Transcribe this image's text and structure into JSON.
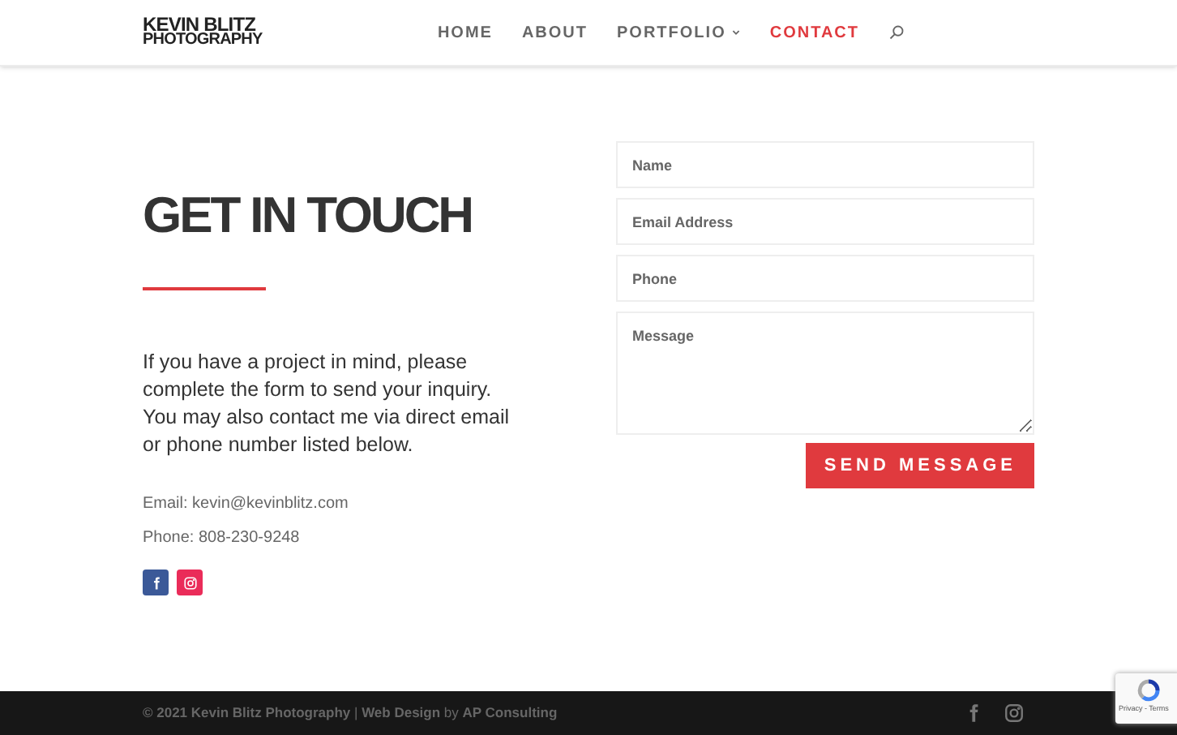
{
  "header": {
    "logo": [
      "KEVIN BLITZ",
      "PHOTOGRAPHY"
    ],
    "nav": [
      {
        "label": "HOME",
        "selected": false,
        "dropdown": false
      },
      {
        "label": "ABOUT",
        "selected": false,
        "dropdown": false
      },
      {
        "label": "PORTFOLIO",
        "selected": false,
        "dropdown": true
      },
      {
        "label": "CONTACT",
        "selected": true,
        "dropdown": false
      }
    ]
  },
  "contact": {
    "title": "GET IN TOUCH",
    "intro": "If you have a project in mind, please complete the form to send your inquiry. You may also contact me via direct email or phone number listed below.",
    "email": "Email: kevin@kevinblitz.com",
    "phone": "Phone: 808-230-9248",
    "social": [
      {
        "kind": "facebook",
        "color": "#3b5998"
      },
      {
        "kind": "instagram",
        "color": "#ea2c59"
      }
    ]
  },
  "form": {
    "fields": [
      {
        "kind": "input",
        "placeholder": "Name"
      },
      {
        "kind": "input",
        "placeholder": "Email Address"
      },
      {
        "kind": "input",
        "placeholder": "Phone"
      },
      {
        "kind": "textarea",
        "placeholder": "Message"
      }
    ],
    "submit": "SEND MESSAGE"
  },
  "footer": {
    "credits": "**© 2021 Kevin Blitz Photography** | **Web Design** by **AP Consulting**",
    "social": [
      {
        "kind": "facebook"
      },
      {
        "kind": "instagram"
      }
    ]
  },
  "recaptcha": {
    "links": "Privacy - Terms"
  }
}
